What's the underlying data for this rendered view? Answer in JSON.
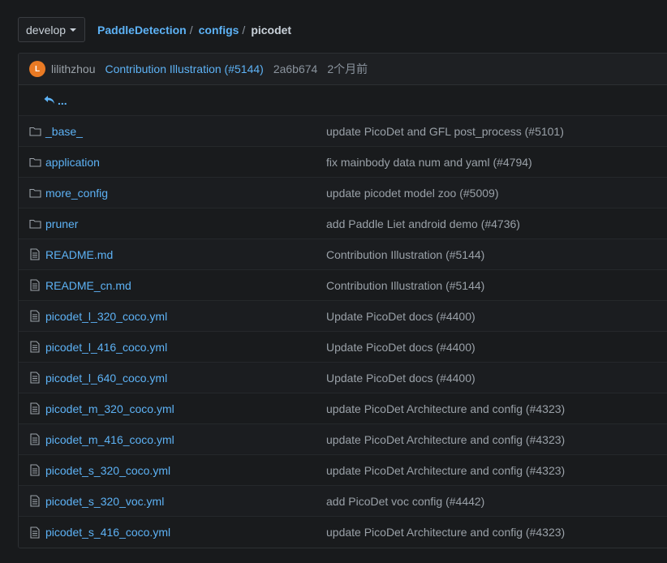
{
  "branch": {
    "label": "develop"
  },
  "breadcrumb": {
    "repo": "PaddleDetection",
    "sep1": "/",
    "folder": "configs",
    "sep2": "/",
    "current": "picodet"
  },
  "latest_commit": {
    "avatar_initial": "L",
    "author": "lilithzhou",
    "message": "Contribution Illustration (#5144)",
    "sha": "2a6b674",
    "time_ago": "2个月前"
  },
  "up_link": {
    "label": "..."
  },
  "files": [
    {
      "type": "folder",
      "icon": "folder-icon",
      "name": "_base_",
      "message": "update PicoDet and GFL post_process (#5101)"
    },
    {
      "type": "folder",
      "icon": "folder-icon",
      "name": "application",
      "message": "fix mainbody data num and yaml (#4794)"
    },
    {
      "type": "folder",
      "icon": "folder-icon",
      "name": "more_config",
      "message": "update picodet model zoo (#5009)"
    },
    {
      "type": "folder",
      "icon": "folder-icon",
      "name": "pruner",
      "message": "add Paddle Liet android demo (#4736)"
    },
    {
      "type": "file",
      "icon": "file-icon",
      "name": "README.md",
      "message": "Contribution Illustration (#5144)"
    },
    {
      "type": "file",
      "icon": "file-icon",
      "name": "README_cn.md",
      "message": "Contribution Illustration (#5144)"
    },
    {
      "type": "file",
      "icon": "file-icon",
      "name": "picodet_l_320_coco.yml",
      "message": "Update PicoDet docs (#4400)"
    },
    {
      "type": "file",
      "icon": "file-icon",
      "name": "picodet_l_416_coco.yml",
      "message": "Update PicoDet docs (#4400)"
    },
    {
      "type": "file",
      "icon": "file-icon",
      "name": "picodet_l_640_coco.yml",
      "message": "Update PicoDet docs (#4400)"
    },
    {
      "type": "file",
      "icon": "file-icon",
      "name": "picodet_m_320_coco.yml",
      "message": "update PicoDet Architecture and config (#4323)"
    },
    {
      "type": "file",
      "icon": "file-icon",
      "name": "picodet_m_416_coco.yml",
      "message": "update PicoDet Architecture and config (#4323)"
    },
    {
      "type": "file",
      "icon": "file-icon",
      "name": "picodet_s_320_coco.yml",
      "message": "update PicoDet Architecture and config (#4323)"
    },
    {
      "type": "file",
      "icon": "file-icon",
      "name": "picodet_s_320_voc.yml",
      "message": "add PicoDet voc config (#4442)"
    },
    {
      "type": "file",
      "icon": "file-icon",
      "name": "picodet_s_416_coco.yml",
      "message": "update PicoDet Architecture and config (#4323)"
    }
  ],
  "colors": {
    "background": "#181a1c",
    "link": "#5db2f5",
    "muted_text": "#9aa1a8",
    "avatar": "#e97a24"
  }
}
